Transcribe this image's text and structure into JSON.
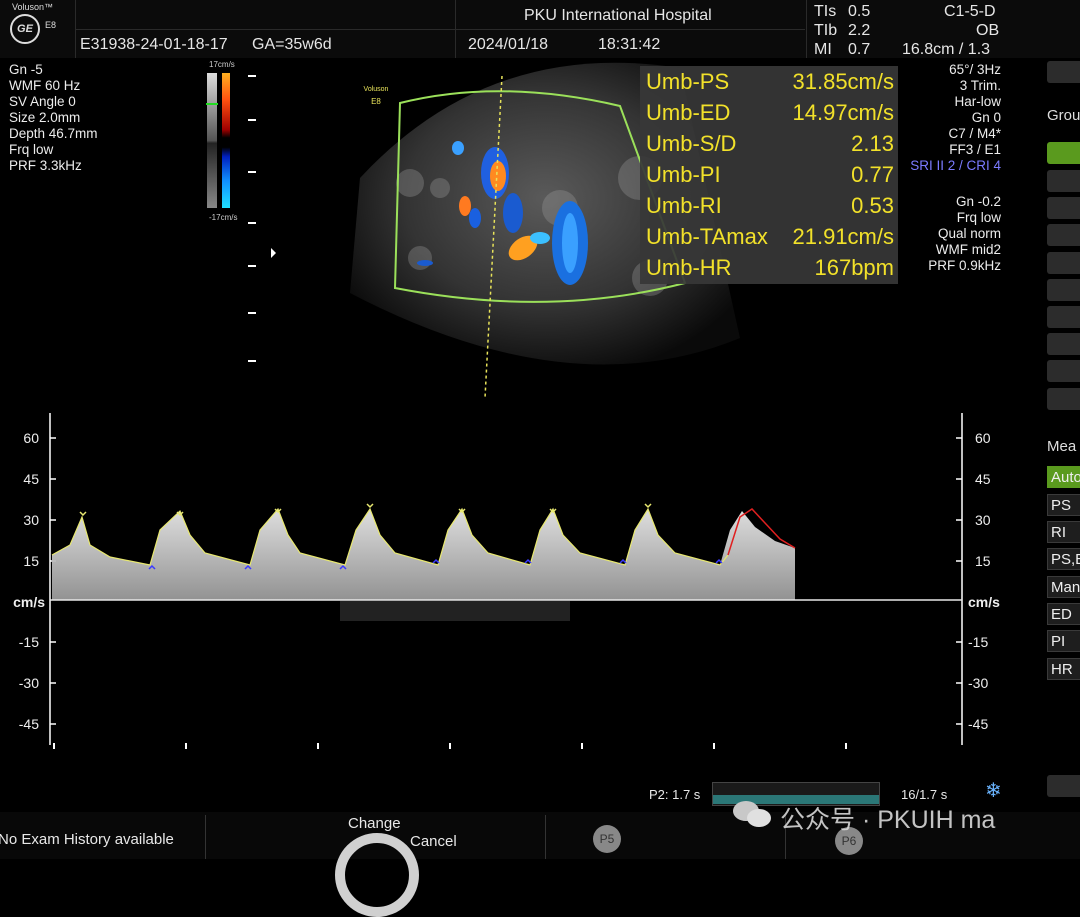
{
  "header": {
    "brand": "Voluson™",
    "model": "E8",
    "logo": "GE",
    "patient_id": "E31938-24-01-18-17",
    "ga": "GA=35w6d",
    "hospital": "PKU International Hospital",
    "date": "2024/01/18",
    "time": "18:31:42",
    "tis": "TIs",
    "tis_val": "0.5",
    "tib": "TIb",
    "tib_val": "2.2",
    "mi": "MI",
    "mi_val": "0.7",
    "probe": "C1-5-D",
    "app": "OB",
    "depth_zoom": "16.8cm / 1.3"
  },
  "left_params": [
    "Gn  -5",
    "WMF 60 Hz",
    "SV Angle  0",
    "Size  2.0mm",
    "Depth 46.7mm",
    "Frq low",
    "PRF  3.3kHz"
  ],
  "colorbar": {
    "top": "17cm/s",
    "bottom": "-17cm/s"
  },
  "image_label": {
    "brand": "Voluson",
    "model": "E8"
  },
  "right_params_top": [
    "65°/  3Hz",
    "3 Trim.",
    "Har-low",
    "Gn  0",
    "C7 / M4*",
    "FF3 / E1"
  ],
  "right_params_sri": "SRI II 2 / CRI 4",
  "right_params_bottom": [
    "Gn -0.2",
    "Frq low",
    "Qual norm",
    "WMF mid2",
    "PRF  0.9kHz"
  ],
  "measurements": [
    {
      "name": "Umb-PS",
      "value": "31.85cm/s"
    },
    {
      "name": "Umb-ED",
      "value": "14.97cm/s"
    },
    {
      "name": "Umb-S/D",
      "value": "2.13"
    },
    {
      "name": "Umb-PI",
      "value": "0.77"
    },
    {
      "name": "Umb-RI",
      "value": "0.53"
    },
    {
      "name": "Umb-TAmax",
      "value": "21.91cm/s"
    },
    {
      "name": "Umb-HR",
      "value": "167bpm"
    }
  ],
  "right_panel": {
    "group_label": "Grou",
    "meas_label": "Mea",
    "menu_items": [
      "Auto",
      "PS",
      "RI",
      "PS,E",
      "Man",
      "ED",
      "PI",
      "HR"
    ]
  },
  "spectral": {
    "y_ticks": [
      "60",
      "45",
      "30",
      "15",
      "cm/s",
      "-15",
      "-30",
      "-45"
    ],
    "unit": "cm/s"
  },
  "cine": {
    "left_label": "P2:  1.7 s",
    "right_label": "16/1.7 s",
    "progress": 1.0
  },
  "footer": {
    "exam_history": "No Exam History available",
    "change": "Change",
    "cancel": "Cancel",
    "p5": "P5",
    "p6": "P6",
    "watermark": "公众号 · PKUIH ma"
  },
  "colors": {
    "measure_text": "#f2e12a",
    "trace": "#e8e870",
    "sector_outline": "#9be05a",
    "active_button": "#5a9a1e",
    "sri_text": "#7b7bff"
  },
  "icons": [
    "ge-logo-icon",
    "freeze-snowflake-icon",
    "wechat-icon",
    "pointer-triangle-icon"
  ]
}
